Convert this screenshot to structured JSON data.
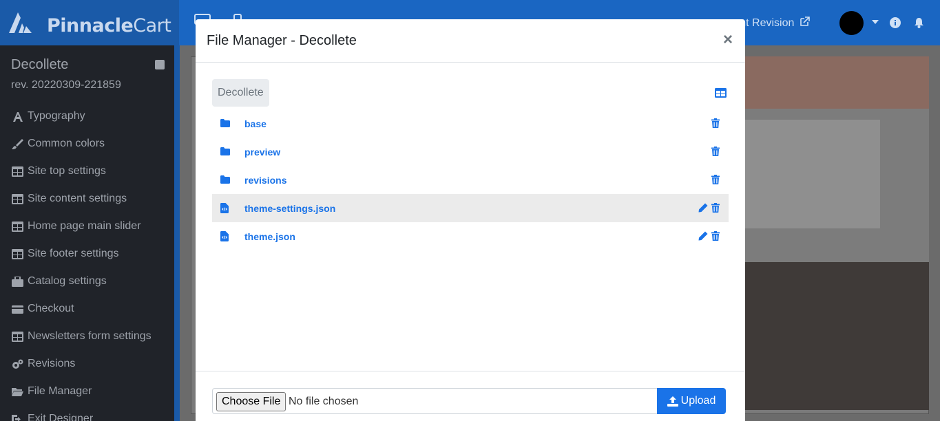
{
  "brand": {
    "name_bold": "Pinnacle",
    "name_thin": "Cart"
  },
  "topbar": {
    "revision_link": "rent Revision"
  },
  "sidebar": {
    "title": "Decollete",
    "revision": "rev. 20220309-221859",
    "items": [
      {
        "label": "Typography",
        "icon": "typography-icon"
      },
      {
        "label": "Common colors",
        "icon": "brush-icon"
      },
      {
        "label": "Site top settings",
        "icon": "table-icon"
      },
      {
        "label": "Site content settings",
        "icon": "table-icon"
      },
      {
        "label": "Home page main slider",
        "icon": "table-icon"
      },
      {
        "label": "Site footer settings",
        "icon": "table-icon"
      },
      {
        "label": "Catalog settings",
        "icon": "briefcase-icon"
      },
      {
        "label": "Checkout",
        "icon": "credit-card-icon"
      },
      {
        "label": "Newsletters form settings",
        "icon": "table-icon"
      },
      {
        "label": "Revisions",
        "icon": "cogs-icon"
      },
      {
        "label": "File Manager",
        "icon": "folder-open-icon"
      },
      {
        "label": "Exit Designer",
        "icon": "exit-icon"
      }
    ]
  },
  "modal": {
    "title": "File Manager - Decollete",
    "close": "×",
    "breadcrumb": "Decollete",
    "files": [
      {
        "name": "base",
        "type": "folder"
      },
      {
        "name": "preview",
        "type": "folder"
      },
      {
        "name": "revisions",
        "type": "folder"
      },
      {
        "name": "theme-settings.json",
        "type": "file"
      },
      {
        "name": "theme.json",
        "type": "file"
      }
    ],
    "choose_file_label": "Choose File",
    "no_file_text": "No file chosen",
    "upload_label": "Upload"
  },
  "colors": {
    "accent": "#1a73e8",
    "topbar": "#1a66c2",
    "sidebar": "#202329"
  }
}
